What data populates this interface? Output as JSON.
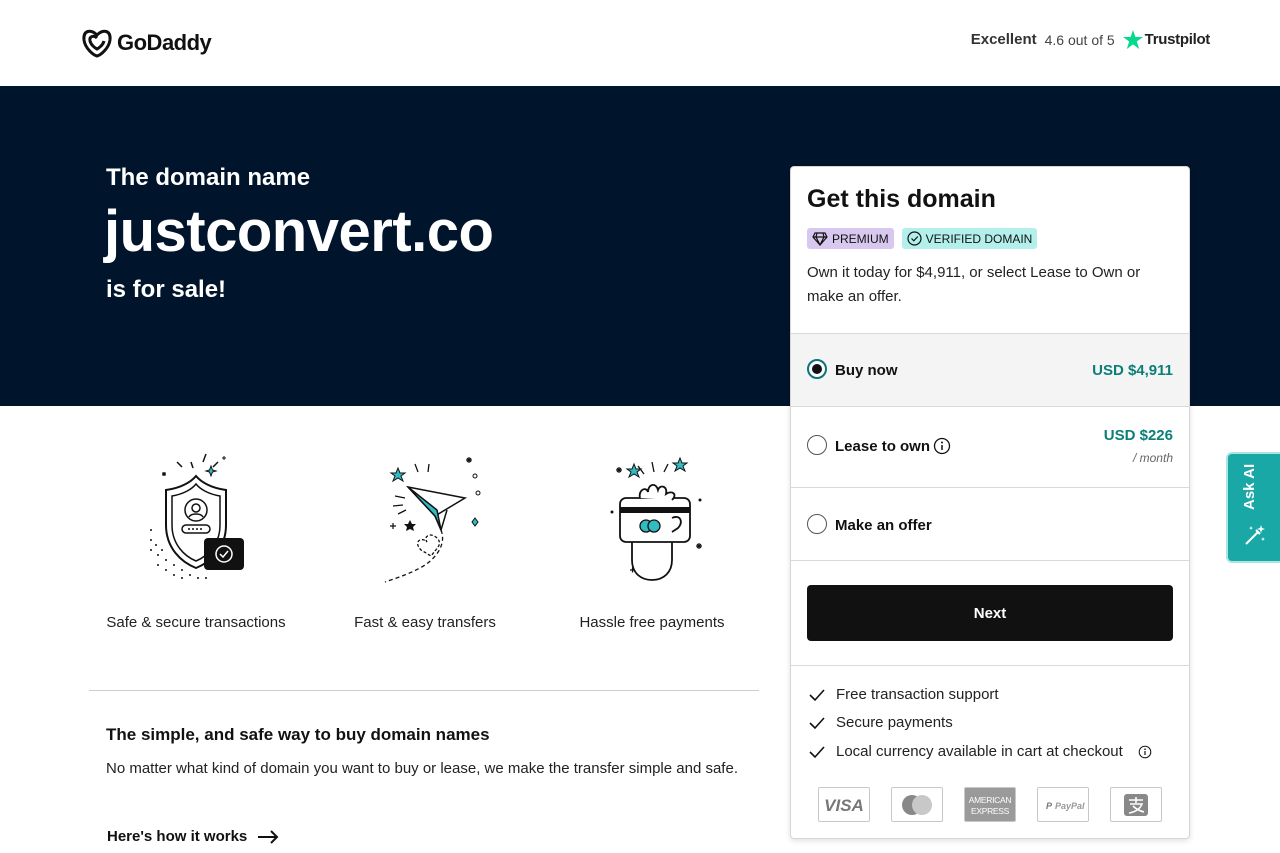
{
  "header": {
    "logo_text": "GoDaddy",
    "rating_word": "Excellent",
    "rating_score": "4.6 out of 5",
    "trustpilot_label": "Trustpilot"
  },
  "hero": {
    "pre_text": "The domain name",
    "domain": "justconvert.co",
    "post_text": "is for sale!"
  },
  "features": [
    {
      "label": "Safe & secure transactions",
      "icon": "shield-icon"
    },
    {
      "label": "Fast & easy transfers",
      "icon": "paper-plane-icon"
    },
    {
      "label": "Hassle free payments",
      "icon": "hand-card-icon"
    }
  ],
  "info": {
    "title": "The simple, and safe way to buy domain names",
    "text": "No matter what kind of domain you want to buy or lease, we make the transfer simple and safe.",
    "link": "Here's how it works"
  },
  "card": {
    "title": "Get this domain",
    "badges": {
      "premium": "PREMIUM",
      "verified": "VERIFIED DOMAIN"
    },
    "description": "Own it today for $4,911, or select Lease to Own or make an offer.",
    "options": {
      "buy": {
        "label": "Buy now",
        "price": "USD $4,911",
        "selected": true
      },
      "lease": {
        "label": "Lease to own",
        "price": "USD $226",
        "sub": "/ month",
        "selected": false
      },
      "offer": {
        "label": "Make an offer",
        "selected": false
      }
    },
    "next_label": "Next",
    "perks": [
      "Free transaction support",
      "Secure payments",
      "Local currency available in cart at checkout"
    ],
    "payment_methods": [
      "VISA",
      "Mastercard",
      "AMERICAN EXPRESS",
      "PayPal",
      "Alipay"
    ]
  },
  "ask_ai": {
    "label": "Ask AI"
  },
  "colors": {
    "hero_bg": "#00142b",
    "price_teal": "#0a7e78",
    "ask_ai_bg": "#1aa8a6",
    "premium_badge": "#d8c8ef",
    "verified_badge": "#b3f0eb"
  }
}
